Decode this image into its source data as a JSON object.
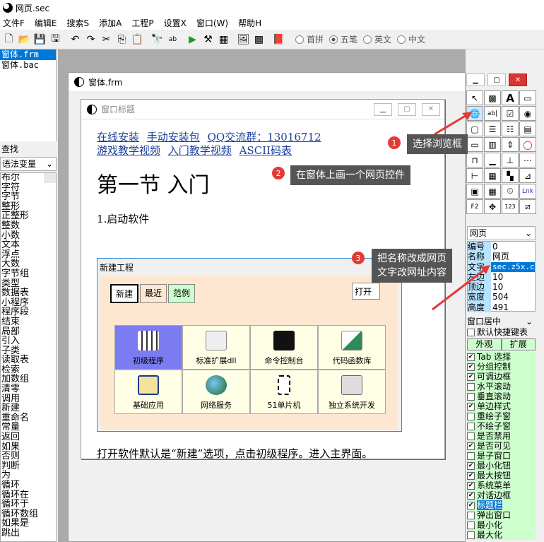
{
  "window": {
    "title": "网页.sec"
  },
  "menu": [
    "文件F",
    "编辑E",
    "搜索S",
    "添加A",
    "工程P",
    "设置X",
    "窗口(W)",
    "帮助H"
  ],
  "input_modes": [
    {
      "label": "首拼",
      "checked": false
    },
    {
      "label": "五笔",
      "checked": true
    },
    {
      "label": "英文",
      "checked": false
    },
    {
      "label": "中文",
      "checked": false
    }
  ],
  "files": [
    "窗体.frm",
    "窗体.bac"
  ],
  "left": {
    "search_label": "查找",
    "combo": "语法变量",
    "keywords": [
      "布尔",
      "字符",
      "字节",
      "整形",
      "正整形",
      "整数",
      "小数",
      "文本",
      "浮点",
      "大数",
      "字节组",
      "类型",
      "数据表",
      "小程序",
      "程序段",
      "结束",
      "局部",
      "引入",
      "子类",
      "读取表",
      "检索",
      "加数组",
      "清零",
      "调用",
      "新建",
      "重命名",
      "常量",
      "返回",
      "如果",
      "否则",
      "判断",
      "为",
      "循环",
      "循环在",
      "循环于",
      "循环数组",
      "如果是",
      "跳出"
    ]
  },
  "designer": {
    "title": "窗体.frm"
  },
  "form": {
    "title": "窗口标题",
    "links1": [
      "在线安装",
      "手动安装包",
      "QQ交流群：13016712"
    ],
    "links2": [
      "游戏教学视频",
      "入门教学视频",
      "ASCII码表"
    ],
    "heading": "第一节  入门",
    "step": "1.启动软件",
    "np_title": "新建工程",
    "np_tabs": [
      "新建",
      "最近",
      "范例"
    ],
    "np_open": "打开",
    "tiles": [
      "初级程序",
      "标准扩展dll",
      "命令控制台",
      "代码函数库",
      "基础应用",
      "网络服务",
      "51单片机",
      "独立系统开发"
    ],
    "bottom_text": "打开软件默认是“新建”选项，点击初级程序。进入主界面。"
  },
  "callouts": [
    {
      "n": "1",
      "text": "选择浏览框"
    },
    {
      "n": "2",
      "text": "在窗体上画一个网页控件"
    },
    {
      "n": "3",
      "text": "把名称改成网页\n文字改网址内容"
    }
  ],
  "props": {
    "combo": "网页",
    "rows": [
      [
        "编号",
        "0"
      ],
      [
        "名称",
        "网页"
      ],
      [
        "文字",
        "sec.z5x.c"
      ],
      [
        "左边",
        "10"
      ],
      [
        "顶边",
        "10"
      ],
      [
        "宽度",
        "504"
      ],
      [
        "高度",
        "491"
      ]
    ]
  },
  "lower": {
    "center": "窗口居中",
    "default_key": "默认快捷键表",
    "tab_outer": "外观",
    "tab_ext": "扩展",
    "checks": [
      [
        "Tab 选择",
        true
      ],
      [
        "分组控制",
        true
      ],
      [
        "可调边框",
        true
      ],
      [
        "水平滚动",
        false
      ],
      [
        "垂直滚动",
        false
      ],
      [
        "单边样式",
        true
      ],
      [
        "重绘子窗",
        false
      ],
      [
        "不绘子窗",
        false
      ],
      [
        "是否禁用",
        false
      ],
      [
        "是否可见",
        true
      ],
      [
        "是子窗口",
        false
      ],
      [
        "最小化钮",
        true
      ],
      [
        "最大按钮",
        true
      ],
      [
        "系统菜单",
        true
      ],
      [
        "对话边框",
        true
      ],
      [
        "标题栏",
        true
      ],
      [
        "弹出窗口",
        false
      ],
      [
        "最小化",
        false
      ],
      [
        "最大化",
        false
      ]
    ]
  },
  "colors": {
    "accent": "#0078d7",
    "link": "#1c3e9c",
    "badge": "#e53935",
    "arrow": "#e53935"
  }
}
